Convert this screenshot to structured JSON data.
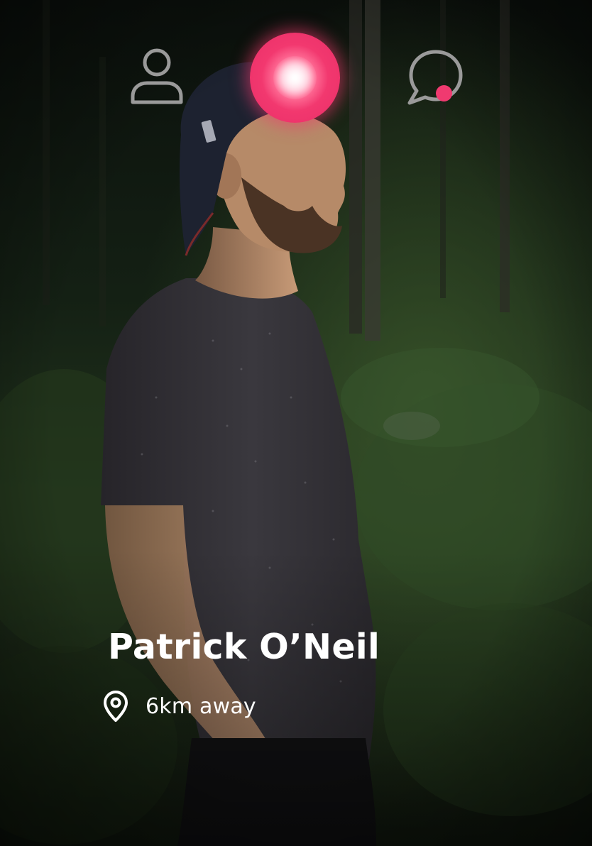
{
  "profile_card": {
    "name": "Patrick O’Neil",
    "distance": "6km away"
  },
  "icons": {
    "profile_tab": "user-icon",
    "discover_tab": "glowing-dot-icon",
    "messages_tab": "chat-bubble-icon",
    "messages_badge": "notification-dot",
    "location": "map-pin-icon"
  },
  "colors": {
    "accent": "#f03a70",
    "text": "#ffffff",
    "nav_icon": "#9a9a9a"
  }
}
